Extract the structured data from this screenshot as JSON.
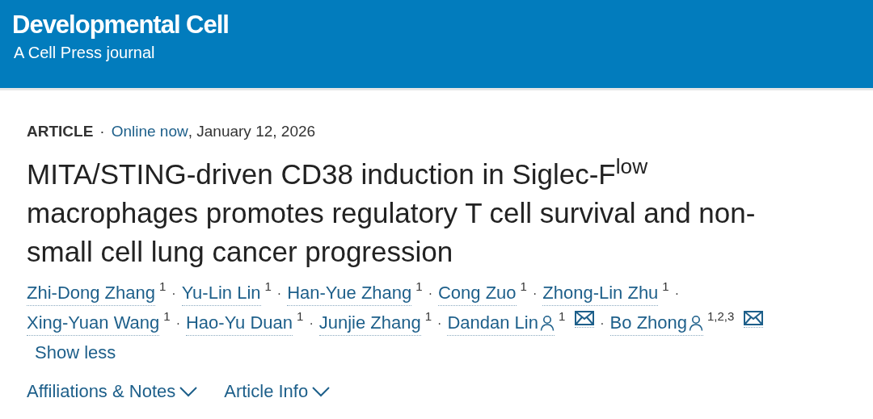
{
  "header": {
    "journal": "Developmental Cell",
    "subtitle": "A Cell Press journal"
  },
  "meta": {
    "type": "ARTICLE",
    "separator": "·",
    "status": "Online now",
    "date": ", January 12, 2026"
  },
  "title_lines": [
    "MITA/STING-driven CD38 induction in Siglec-F$^{low}$",
    "macrophages promotes regulatory T cell survival and non-",
    "small cell lung cancer progression"
  ],
  "author_lines": [
    [
      {
        "name": "Zhi-Dong Zhang",
        "affiliation": "1",
        "corresponding": false,
        "separator": "·"
      },
      {
        "name": "Yu-Lin Lin",
        "affiliation": "1",
        "corresponding": false,
        "separator": "·"
      },
      {
        "name": "Han-Yue Zhang",
        "affiliation": "1",
        "corresponding": false,
        "separator": "·"
      },
      {
        "name": "Cong Zuo",
        "affiliation": "1",
        "corresponding": false,
        "separator": "·"
      },
      {
        "name": "Zhong-Lin Zhu",
        "affiliation": "1",
        "corresponding": false,
        "separator": "·"
      }
    ],
    [
      {
        "name": "Xing-Yuan Wang",
        "affiliation": "1",
        "corresponding": false,
        "separator": "·"
      },
      {
        "name": "Hao-Yu Duan",
        "affiliation": "1",
        "corresponding": false,
        "separator": "·"
      },
      {
        "name": "Junjie Zhang",
        "affiliation": "1",
        "corresponding": false,
        "separator": "·"
      },
      {
        "name": "Dandan Lin",
        "affiliation": "1",
        "corresponding": true,
        "separator": "·"
      },
      {
        "name": "Bo Zhong",
        "affiliation": "1,2,3",
        "corresponding": true
      }
    ]
  ],
  "show_less": "Show less",
  "sections": [
    {
      "label": "Affiliations & Notes",
      "expanded": false
    },
    {
      "label": "Article Info",
      "expanded": false
    }
  ]
}
